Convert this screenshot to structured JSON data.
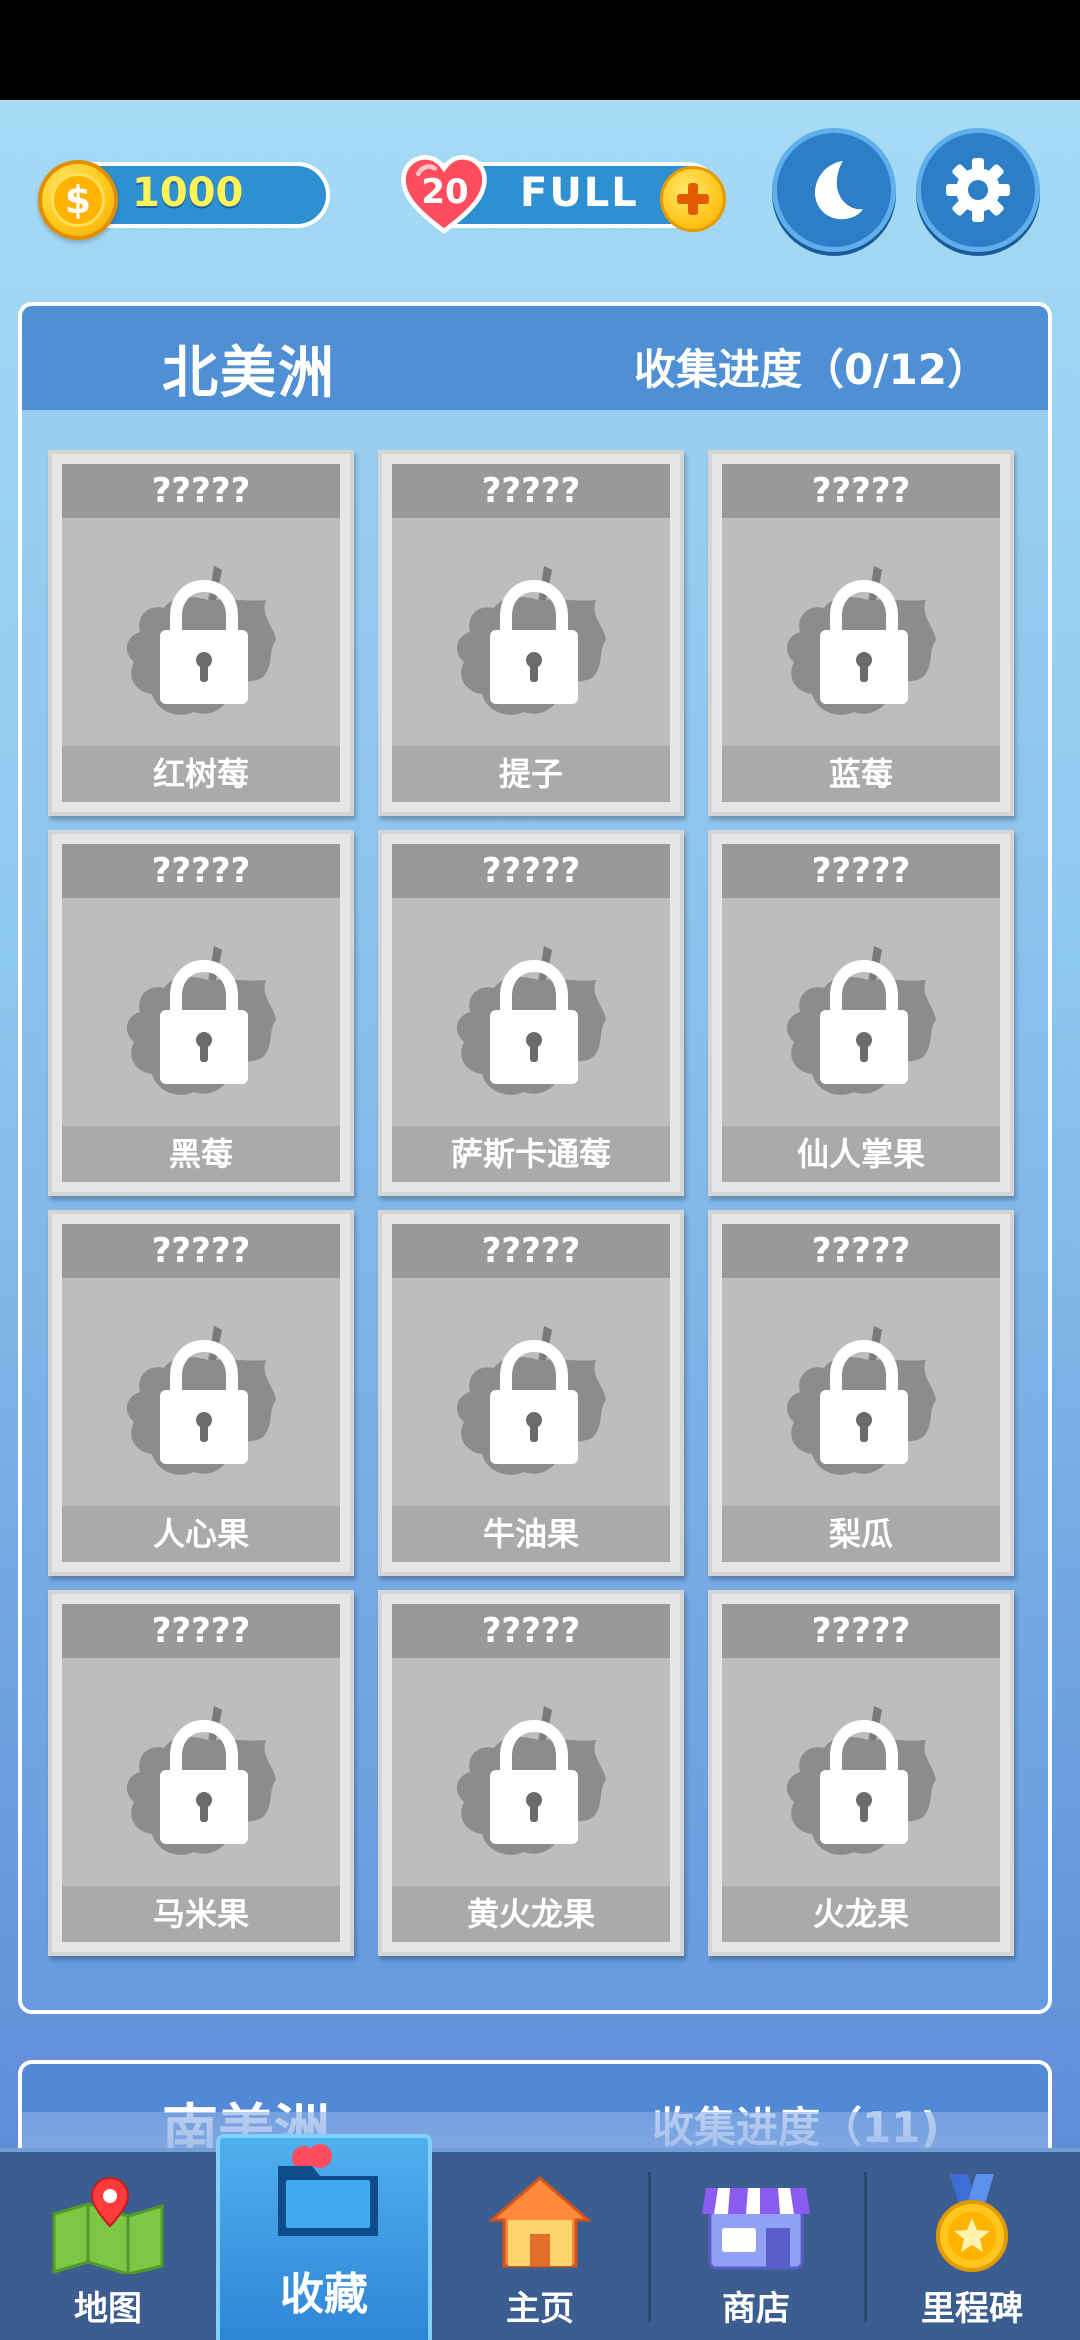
{
  "hud": {
    "coins": "1000",
    "coin_symbol": "$",
    "lives": "20",
    "life_status": "FULL"
  },
  "region": {
    "title": "北美洲",
    "progress": "收集进度（0/12）"
  },
  "cards": [
    {
      "hidden": "?????",
      "name": "红树莓"
    },
    {
      "hidden": "?????",
      "name": "提子"
    },
    {
      "hidden": "?????",
      "name": "蓝莓"
    },
    {
      "hidden": "?????",
      "name": "黑莓"
    },
    {
      "hidden": "?????",
      "name": "萨斯卡通莓"
    },
    {
      "hidden": "?????",
      "name": "仙人掌果"
    },
    {
      "hidden": "?????",
      "name": "人心果"
    },
    {
      "hidden": "?????",
      "name": "牛油果"
    },
    {
      "hidden": "?????",
      "name": "梨瓜"
    },
    {
      "hidden": "?????",
      "name": "马米果"
    },
    {
      "hidden": "?????",
      "name": "黄火龙果"
    },
    {
      "hidden": "?????",
      "name": "火龙果"
    }
  ],
  "next_region": {
    "title": "南美洲",
    "progress": "收集进度（11)"
  },
  "nav": {
    "map": "地图",
    "collection": "收藏",
    "home": "主页",
    "shop": "商店",
    "milestone": "里程碑"
  },
  "colors": {
    "accent": "#2f84d5",
    "coin": "#ffc91a",
    "heart": "#ff4d5e"
  }
}
